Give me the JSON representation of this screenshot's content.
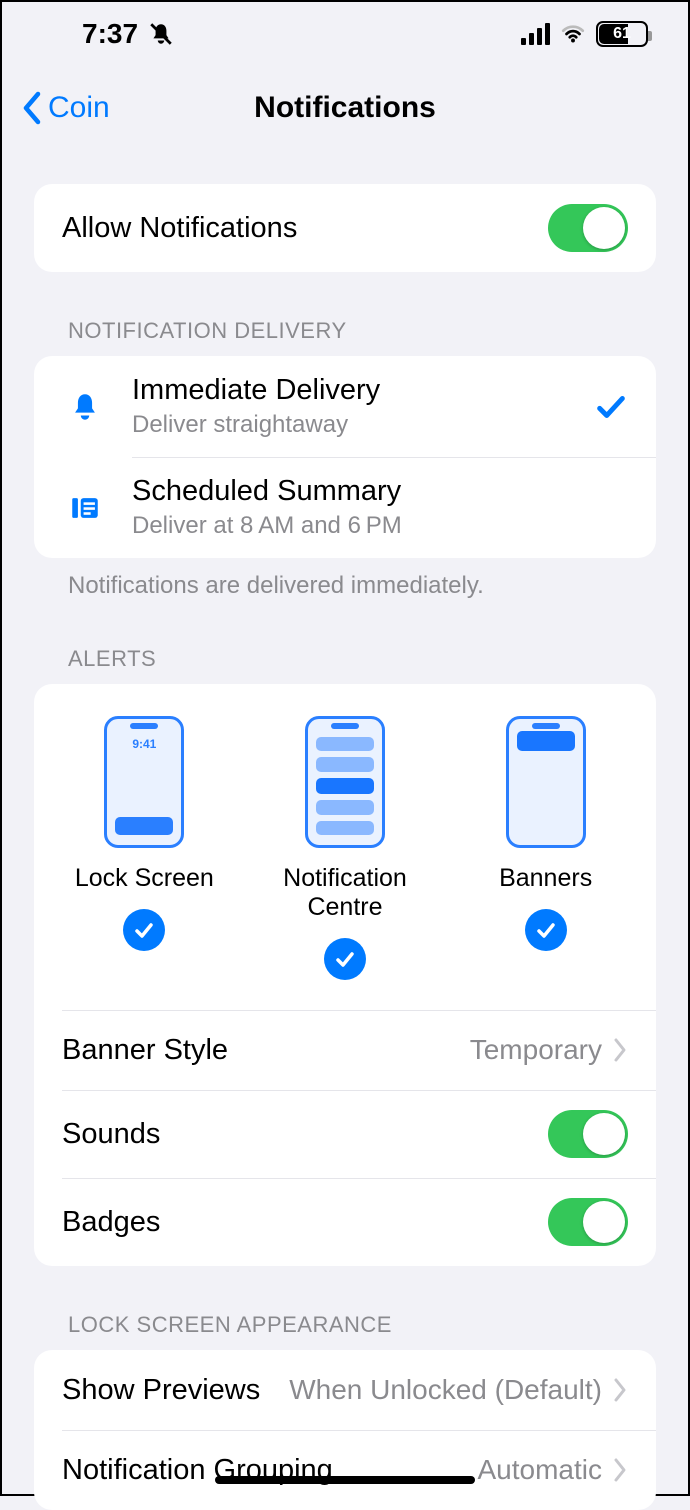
{
  "status": {
    "time": "7:37",
    "battery_pct": "61"
  },
  "nav": {
    "back_label": "Coin",
    "title": "Notifications"
  },
  "allow": {
    "label": "Allow Notifications",
    "on": true
  },
  "delivery": {
    "header": "NOTIFICATION DELIVERY",
    "footer": "Notifications are delivered immediately.",
    "options": [
      {
        "title": "Immediate Delivery",
        "sub": "Deliver straightaway",
        "icon": "bell-icon",
        "selected": true
      },
      {
        "title": "Scheduled Summary",
        "sub": "Deliver at 8 AM and 6 PM",
        "icon": "summary-icon",
        "selected": false
      }
    ]
  },
  "alerts": {
    "header": "ALERTS",
    "previews": [
      {
        "label": "Lock Screen",
        "checked": true
      },
      {
        "label": "Notification Centre",
        "checked": true
      },
      {
        "label": "Banners",
        "checked": true
      }
    ],
    "phone_time": "9:41",
    "banner_style": {
      "label": "Banner Style",
      "value": "Temporary"
    },
    "sounds": {
      "label": "Sounds",
      "on": true
    },
    "badges": {
      "label": "Badges",
      "on": true
    }
  },
  "lockscreen": {
    "header": "LOCK SCREEN APPEARANCE",
    "previews": {
      "label": "Show Previews",
      "value": "When Unlocked (Default)"
    },
    "grouping": {
      "label": "Notification Grouping",
      "value": "Automatic"
    }
  }
}
